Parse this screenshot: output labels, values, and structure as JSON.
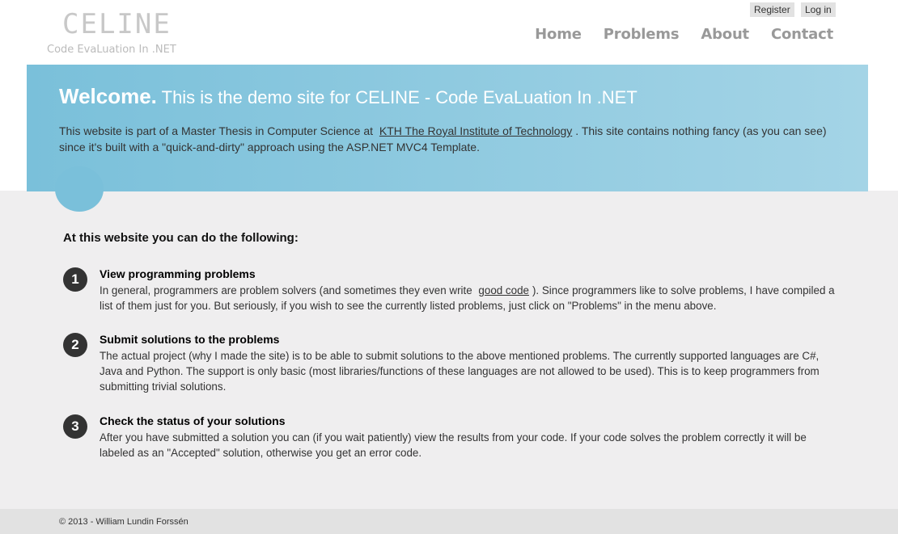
{
  "header": {
    "logo_title": "CELINE",
    "logo_subtitle": "Code EvaLuation In .NET",
    "register": "Register",
    "login": "Log in",
    "nav": [
      "Home",
      "Problems",
      "About",
      "Contact"
    ]
  },
  "featured": {
    "heading_strong": "Welcome.",
    "heading_rest": "This is the demo site for CELINE - Code EvaLuation In .NET",
    "text_before": "This website is part of a Master Thesis in Computer Science at",
    "link": "KTH The Royal Institute of Technology",
    "text_after": ". This site contains nothing fancy (as you can see) since it's built with a \"quick-and-dirty\" approach using the ASP.NET MVC4 Template.",
    "color": "#7ac0da"
  },
  "main": {
    "title": "At this website you can do the following:",
    "steps": [
      {
        "number": "1",
        "title": "View programming problems",
        "text_before": "In general, programmers are problem solvers (and sometimes they even write",
        "link": "good code",
        "text_after": "). Since programmers like to solve problems, I have compiled a list of them just for you. But seriously, if you wish to see the currently listed problems, just click on \"Problems\" in the menu above."
      },
      {
        "number": "2",
        "title": "Submit solutions to the problems",
        "text": "The actual project (why I made the site) is to be able to submit solutions to the above mentioned problems. The currently supported languages are C#, Java and Python. The support is only basic (most libraries/functions of these languages are not allowed to be used). This is to keep programmers from submitting trivial solutions."
      },
      {
        "number": "3",
        "title": "Check the status of your solutions",
        "text": "After you have submitted a solution you can (if you wait patiently) view the results from your code. If your code solves the problem correctly it will be labeled as an \"Accepted\" solution, otherwise you get an error code."
      }
    ]
  },
  "footer": {
    "text": "© 2013 - William Lundin Forssén"
  }
}
